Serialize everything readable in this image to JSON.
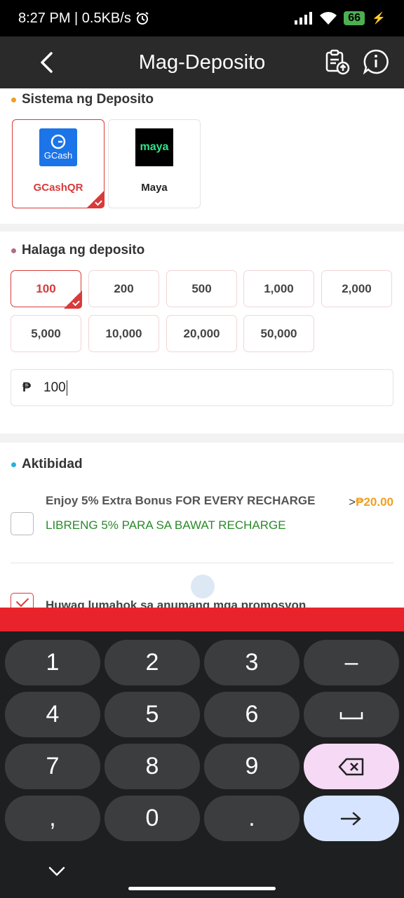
{
  "status_bar": {
    "time_speed": "8:27 PM | 0.5KB/s",
    "battery": "66"
  },
  "header": {
    "title": "Mag-Deposito"
  },
  "deposit_system": {
    "title": "Sistema ng Deposito",
    "methods": [
      {
        "label": "GCashQR",
        "logo_text": "GCash",
        "selected": true
      },
      {
        "label": "Maya",
        "logo_text": "maya",
        "selected": false
      }
    ]
  },
  "deposit_amount": {
    "title": "Halaga ng deposito",
    "options": [
      "100",
      "200",
      "500",
      "1,000",
      "2,000",
      "5,000",
      "10,000",
      "20,000",
      "50,000"
    ],
    "selected": "100",
    "currency": "₱",
    "input_value": "100"
  },
  "activity": {
    "title": "Aktibidad",
    "promos": [
      {
        "title": "Enjoy 5% Extra Bonus FOR EVERY RECHARGE",
        "subtitle": "LIBRENG 5% PARA SA BAWAT RECHARGE",
        "bonus_prefix": ">",
        "bonus": "₱20.00",
        "checked": false
      },
      {
        "title": "Huwag lumahok sa anumang mga promosyon",
        "checked": true
      }
    ]
  },
  "keyboard": {
    "keys": [
      "1",
      "2",
      "3",
      "–",
      "4",
      "5",
      "6",
      "␣",
      "7",
      "8",
      "9",
      "⌫",
      ",",
      "0",
      ".",
      "→"
    ]
  },
  "colors": {
    "accent": "#d93a3a",
    "submit": "#e8232b",
    "bonus": "#f0a020",
    "promo_green": "#2a8a2a"
  }
}
